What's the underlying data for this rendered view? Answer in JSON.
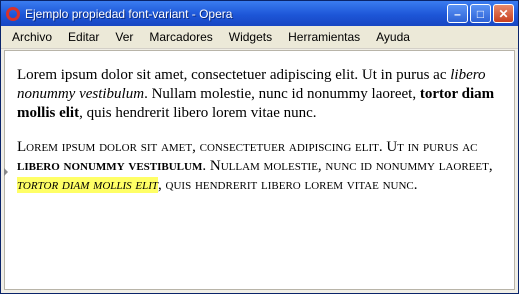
{
  "window": {
    "title": "Ejemplo propiedad font-variant - Opera"
  },
  "controls": {
    "minimize": "–",
    "maximize": "□",
    "close": "✕"
  },
  "menu": [
    "Archivo",
    "Editar",
    "Ver",
    "Marcadores",
    "Widgets",
    "Herramientas",
    "Ayuda"
  ],
  "para1": {
    "a": "Lorem ipsum dolor sit amet, consectetuer adipiscing elit. Ut in purus ac ",
    "b": "libero nonummy vestibulum",
    "c": ". Nullam molestie, nunc id nonummy laoreet, ",
    "d": "tortor diam mollis elit",
    "e": ", quis hendrerit libero lorem vitae nunc."
  },
  "para2": {
    "a": "Lorem ipsum dolor sit amet, consectetuer adipiscing elit. Ut in purus ac ",
    "b": "libero nonummy vestibulum",
    "c": ". Nullam molestie, nunc id nonummy laoreet, ",
    "d": "tortor diam mollis elit",
    "e": ", quis hendrerit libero lorem vitae nunc."
  }
}
